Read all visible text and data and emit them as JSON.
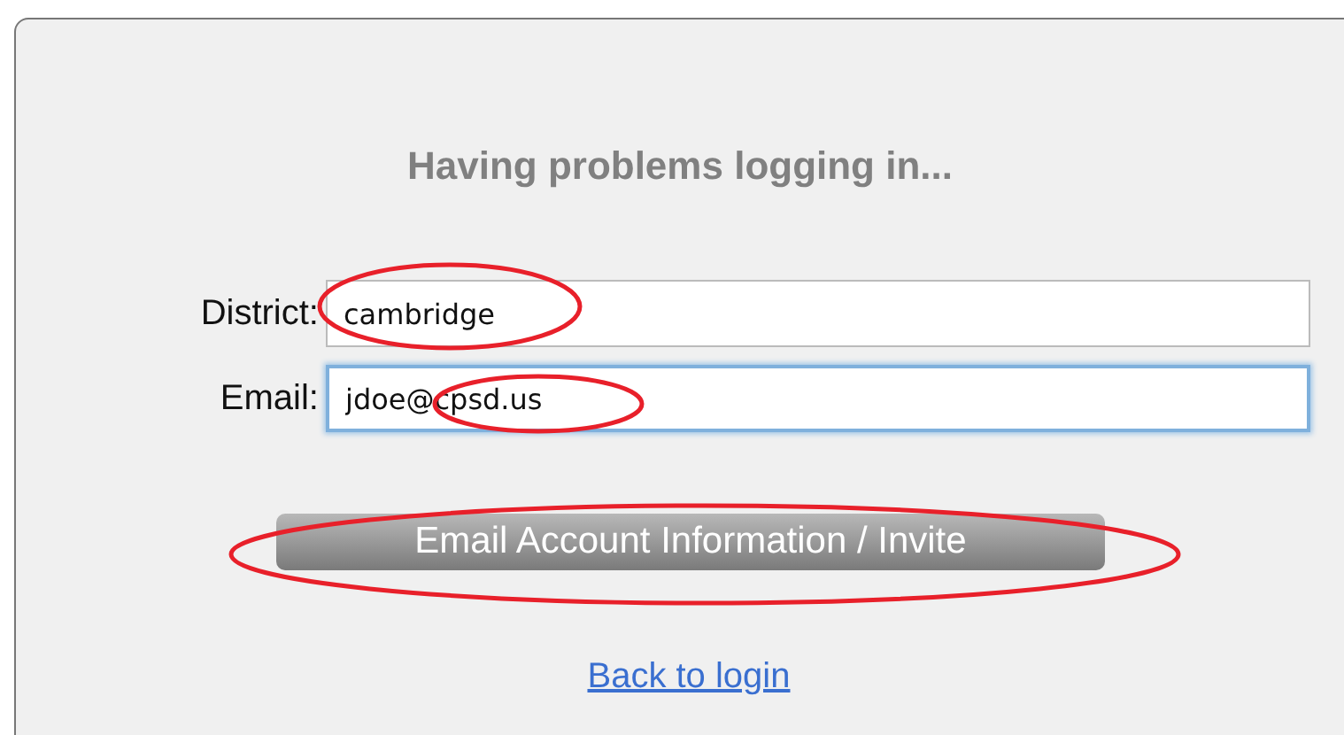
{
  "title": "Having problems logging in...",
  "fields": [
    {
      "label": "District:",
      "value": "cambridge",
      "focused": false,
      "circled": true
    },
    {
      "label": "Email:",
      "value": "jdoe@cpsd.us",
      "focused": true,
      "circled": true
    }
  ],
  "button": {
    "label": "Email Account Information / Invite",
    "circled": true
  },
  "link": "Back to login"
}
